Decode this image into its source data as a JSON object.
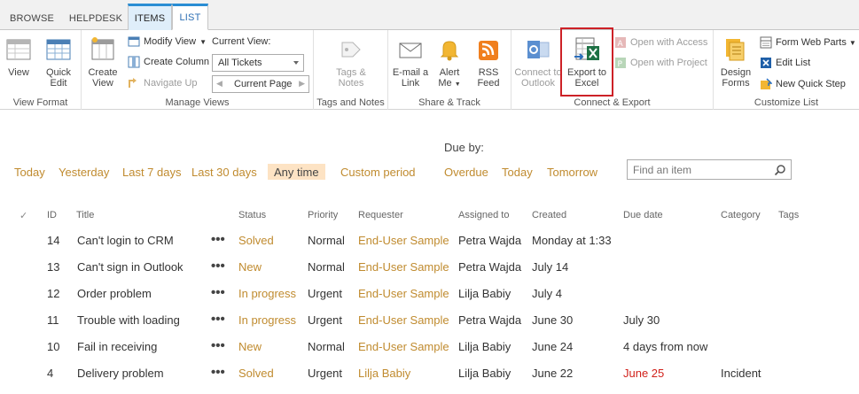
{
  "tabs": [
    {
      "label": "BROWSE"
    },
    {
      "label": "HELPDESK"
    },
    {
      "label": "ITEMS"
    },
    {
      "label": "LIST"
    }
  ],
  "ribbon": {
    "view_format": {
      "label": "View Format",
      "view": "View",
      "quick_edit": "Quick Edit"
    },
    "manage_views": {
      "label": "Manage Views",
      "create_view": "Create View",
      "modify_view": "Modify View",
      "create_column": "Create Column",
      "navigate_up": "Navigate Up",
      "current_view_label": "Current View:",
      "current_view_value": "All Tickets",
      "current_page": "Current Page"
    },
    "tags_notes": {
      "label": "Tags and Notes",
      "tags_notes_btn": "Tags & Notes"
    },
    "share_track": {
      "label": "Share & Track",
      "email_link": "E-mail a Link",
      "alert_me": "Alert Me",
      "rss_feed": "RSS Feed"
    },
    "connect_export": {
      "label": "Connect & Export",
      "connect_outlook": "Connect to Outlook",
      "export_excel": "Export to Excel",
      "open_access": "Open with Access",
      "open_project": "Open with Project"
    },
    "customize": {
      "label": "Customize List",
      "design_forms": "Design Forms",
      "form_web_parts": "Form Web Parts",
      "edit_list": "Edit List",
      "new_quick_step": "New Quick Step"
    }
  },
  "filters": {
    "due_by_label": "Due by:",
    "range_options": [
      "Today",
      "Yesterday",
      "Last 7 days",
      "Last 30 days",
      "Any time",
      "Custom period"
    ],
    "selected_range": "Any time",
    "due_options": [
      "Overdue",
      "Today",
      "Tomorrow"
    ]
  },
  "search": {
    "placeholder": "Find an item"
  },
  "table": {
    "columns": [
      "✓",
      "ID",
      "Title",
      "Status",
      "Priority",
      "Requester",
      "Assigned to",
      "Created",
      "Due date",
      "Category",
      "Tags"
    ],
    "rows": [
      {
        "id": "14",
        "title": "Can't login to CRM",
        "status": "Solved",
        "priority": "Normal",
        "requester": "End-User Sample",
        "assigned": "Petra Wajda",
        "created": "Monday at 1:33",
        "due": "",
        "due_overdue": false,
        "category": "",
        "tags": ""
      },
      {
        "id": "13",
        "title": "Can't sign in Outlook",
        "status": "New",
        "priority": "Normal",
        "requester": "End-User Sample",
        "assigned": "Petra Wajda",
        "created": "July 14",
        "due": "",
        "due_overdue": false,
        "category": "",
        "tags": ""
      },
      {
        "id": "12",
        "title": "Order problem",
        "status": "In progress",
        "priority": "Urgent",
        "requester": "End-User Sample",
        "assigned": "Lilja Babiy",
        "created": "July 4",
        "due": "",
        "due_overdue": false,
        "category": "",
        "tags": ""
      },
      {
        "id": "11",
        "title": "Trouble with loading",
        "status": "In progress",
        "priority": "Urgent",
        "requester": "End-User Sample",
        "assigned": "Petra Wajda",
        "created": "June 30",
        "due": "July 30",
        "due_overdue": false,
        "category": "",
        "tags": ""
      },
      {
        "id": "10",
        "title": "Fail in receiving",
        "status": "New",
        "priority": "Normal",
        "requester": "End-User Sample",
        "assigned": "Lilja Babiy",
        "created": "June 24",
        "due": "4 days from now",
        "due_overdue": false,
        "category": "",
        "tags": ""
      },
      {
        "id": "4",
        "title": "Delivery problem",
        "status": "Solved",
        "priority": "Urgent",
        "requester": "Lilja Babiy",
        "assigned": "Lilja Babiy",
        "created": "June 22",
        "due": "June 25",
        "due_overdue": true,
        "category": "Incident",
        "tags": ""
      }
    ],
    "row_menu_glyph": "•••"
  },
  "colors": {
    "link": "#c08b2f",
    "accent": "#2a8dd4",
    "overdue": "#d1211b",
    "selected_filter_bg": "#fde3c4",
    "highlight_border": "#cd2127"
  }
}
